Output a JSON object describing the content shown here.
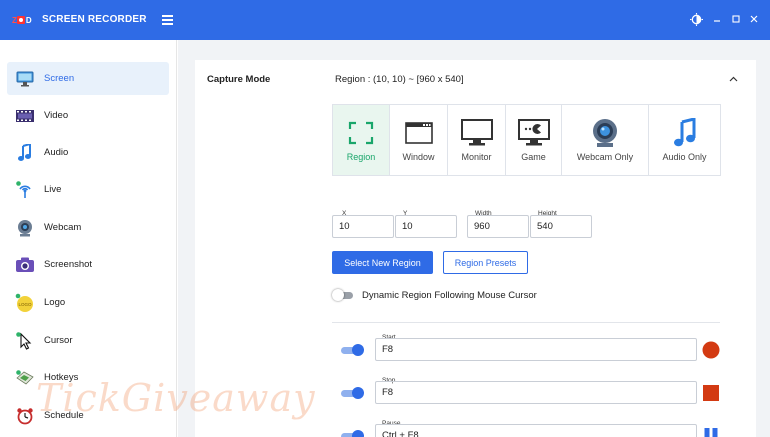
{
  "app": {
    "title": "SCREEN RECORDER",
    "logo_text": "ZD",
    "accent_color": "#2f6be6"
  },
  "window_controls": [
    "theme-icon",
    "minimize-icon",
    "maximize-icon",
    "close-icon"
  ],
  "sidebar": {
    "items": [
      {
        "label": "Screen",
        "icon": "monitor-icon",
        "active": true
      },
      {
        "label": "Video",
        "icon": "film-icon",
        "active": false
      },
      {
        "label": "Audio",
        "icon": "music-note-icon",
        "active": false
      },
      {
        "label": "Live",
        "icon": "broadcast-icon",
        "active": false
      },
      {
        "label": "Webcam",
        "icon": "webcam-icon",
        "active": false
      },
      {
        "label": "Screenshot",
        "icon": "camera-icon",
        "active": false
      },
      {
        "label": "Logo",
        "icon": "logo-badge-icon",
        "active": false
      },
      {
        "label": "Cursor",
        "icon": "cursor-icon",
        "active": false
      },
      {
        "label": "Hotkeys",
        "icon": "keyboard-icon",
        "active": false
      },
      {
        "label": "Schedule",
        "icon": "alarm-clock-icon",
        "active": false
      }
    ]
  },
  "capture": {
    "label": "Capture Mode",
    "region_info": "Region : (10, 10) ~ [960 x 540]",
    "modes": [
      {
        "label": "Region",
        "icon": "region-icon",
        "active": true
      },
      {
        "label": "Window",
        "icon": "window-icon",
        "active": false
      },
      {
        "label": "Monitor",
        "icon": "monitor-icon",
        "active": false
      },
      {
        "label": "Game",
        "icon": "game-icon",
        "active": false
      },
      {
        "label": "Webcam Only",
        "icon": "webcam-icon",
        "active": false
      },
      {
        "label": "Audio Only",
        "icon": "music-note-icon",
        "active": false
      }
    ],
    "fields": {
      "x": {
        "label": "X",
        "value": "10"
      },
      "y": {
        "label": "Y",
        "value": "10"
      },
      "width": {
        "label": "Width",
        "value": "960"
      },
      "height": {
        "label": "Height",
        "value": "540"
      }
    },
    "select_region_label": "Select New Region",
    "region_presets_label": "Region Presets",
    "dynamic_region_label": "Dynamic Region Following Mouse Cursor",
    "dynamic_region_enabled": false
  },
  "hotkeys": [
    {
      "label": "Start",
      "value": "F8",
      "enabled": true,
      "indicator": "record-icon",
      "color": "#d33a12"
    },
    {
      "label": "Stop",
      "value": "F8",
      "enabled": true,
      "indicator": "stop-icon",
      "color": "#d33a12"
    },
    {
      "label": "Pause",
      "value": "Ctrl + F8",
      "enabled": true,
      "indicator": "pause-icon",
      "color": "#2f6be6"
    }
  ],
  "watermark": "TickGiveaway"
}
